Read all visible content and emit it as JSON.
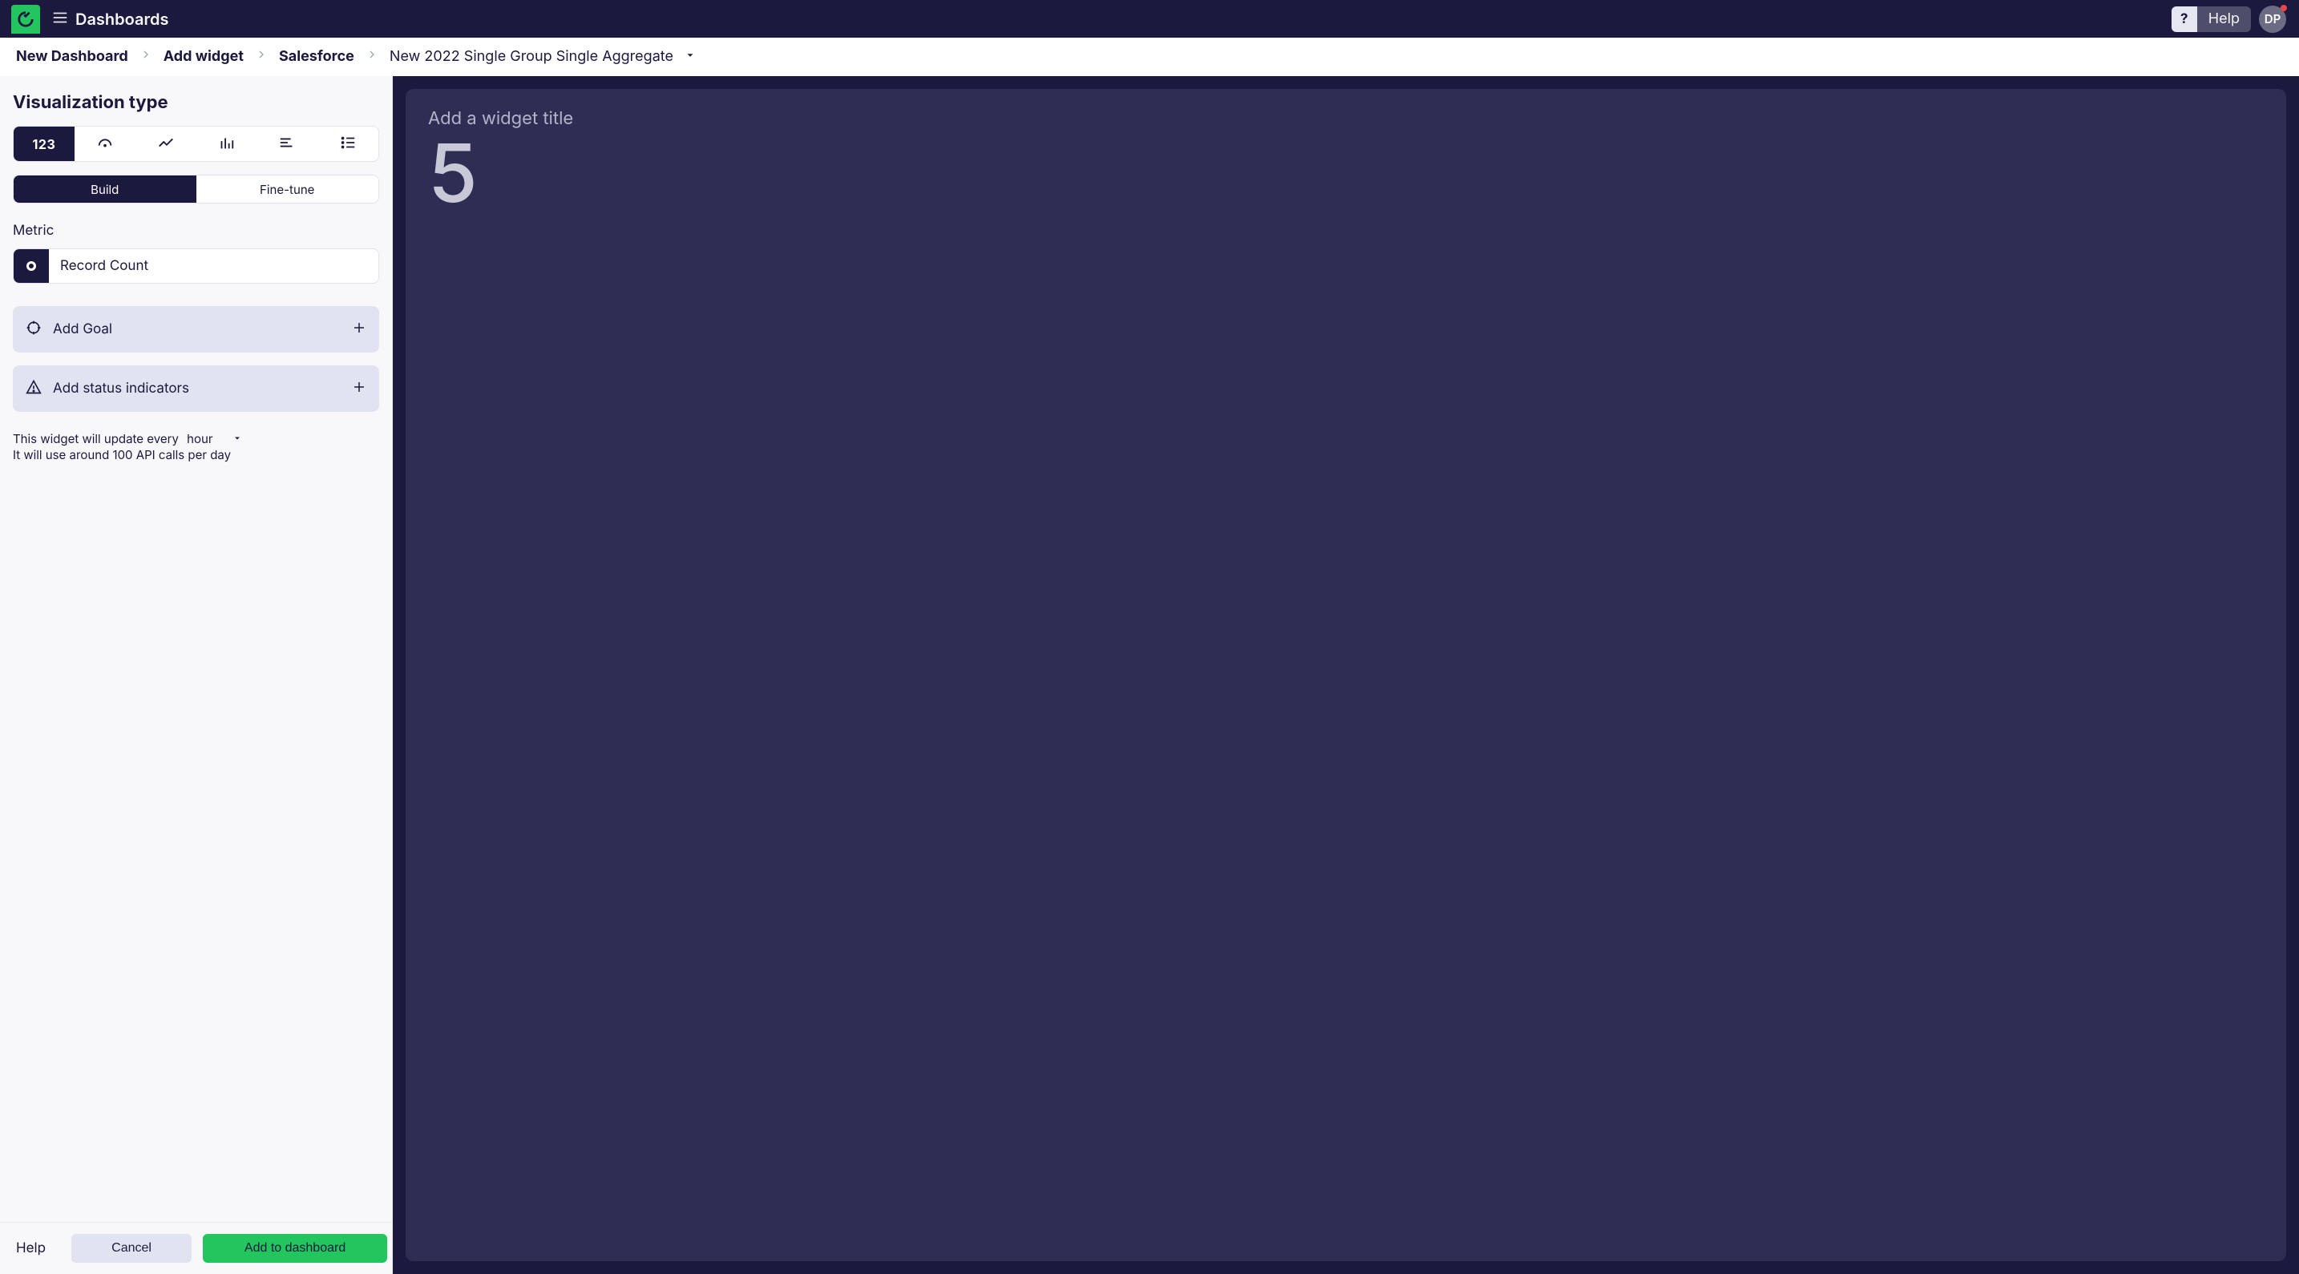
{
  "topbar": {
    "title": "Dashboards",
    "help_q": "?",
    "help_label": "Help",
    "avatar_initials": "DP"
  },
  "breadcrumbs": {
    "item1": "New Dashboard",
    "item2": "Add widget",
    "item3": "Salesforce",
    "current": "New 2022 Single Group Single Aggregate"
  },
  "left": {
    "section_title": "Visualization type",
    "viz_tabs": {
      "number_label": "123"
    },
    "mode_tabs": {
      "build": "Build",
      "finetune": "Fine-tune"
    },
    "metric_label": "Metric",
    "metric_value": "Record Count",
    "add_goal": "Add Goal",
    "add_status": "Add status indicators",
    "update_prefix": "This widget will update every ",
    "update_freq": "hour",
    "update_api": "It will use around 100 API calls per day",
    "footer": {
      "help": "Help",
      "cancel": "Cancel",
      "add": "Add to dashboard"
    }
  },
  "preview": {
    "title_placeholder": "Add a widget title",
    "value": "5"
  },
  "chart_data": {
    "type": "table",
    "title": "Add a widget title",
    "values": [
      5
    ],
    "note": "single aggregate number widget"
  }
}
